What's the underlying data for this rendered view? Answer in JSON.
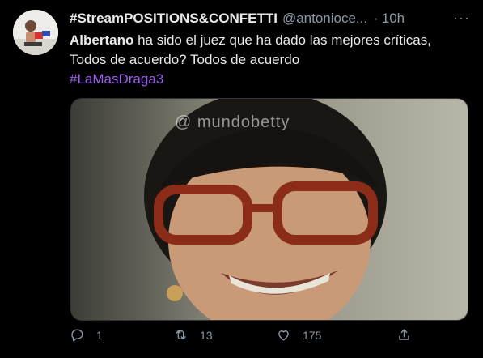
{
  "tweet": {
    "display_name": "#StreamPOSITIONS&CONFETTI",
    "handle": "@antonioce...",
    "separator": "·",
    "time": "10h",
    "more_label": "···",
    "text_bold": "Albertano",
    "text_line1_rest": " ha sido el juez que ha dado las mejores críticas,",
    "text_line2": "Todos de acuerdo? Todos de acuerdo",
    "hashtag": "#LaMasDraga3",
    "media_watermark": "@ mundobetty"
  },
  "actions": {
    "reply_count": "1",
    "retweet_count": "13",
    "like_count": "175"
  },
  "icons": {
    "reply": "reply-icon",
    "retweet": "retweet-icon",
    "like": "heart-icon",
    "share": "share-icon"
  },
  "colors": {
    "background": "#000000",
    "hashtag": "#9a5cf0",
    "muted": "#8b98a5"
  }
}
